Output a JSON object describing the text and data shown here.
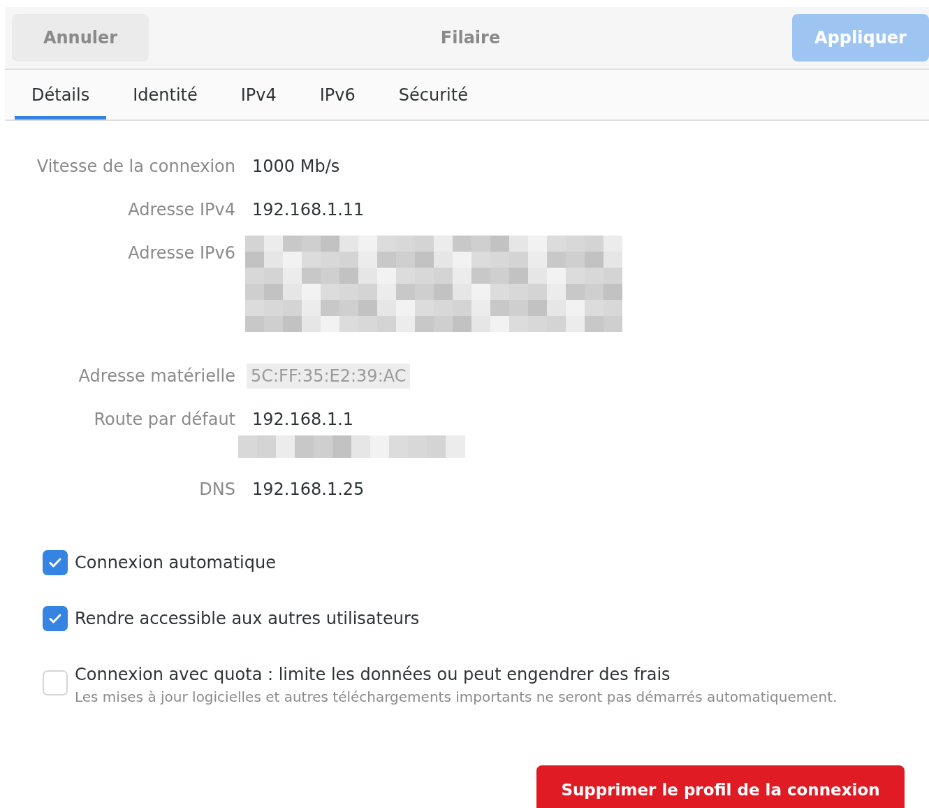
{
  "header": {
    "cancel": "Annuler",
    "title": "Filaire",
    "apply": "Appliquer",
    "apply_disabled": true
  },
  "tabs": [
    {
      "label": "Détails",
      "selected": true
    },
    {
      "label": "Identité",
      "selected": false
    },
    {
      "label": "IPv4",
      "selected": false
    },
    {
      "label": "IPv6",
      "selected": false
    },
    {
      "label": "Sécurité",
      "selected": false
    }
  ],
  "details": [
    {
      "label": "Vitesse de la connexion",
      "kind": "text",
      "value": "1000 Mb/s"
    },
    {
      "label": "Adresse IPv4",
      "kind": "text",
      "value": "192.168.1.11"
    },
    {
      "label": "Adresse IPv6",
      "kind": "redacted"
    },
    {
      "label": "Adresse matérielle",
      "kind": "faint",
      "value": "5C:FF:35:E2:39:AC"
    },
    {
      "label": "Route par défaut",
      "kind": "text_redacted",
      "value": "192.168.1.1"
    },
    {
      "label": "DNS",
      "kind": "text",
      "value": "192.168.1.25"
    }
  ],
  "options": [
    {
      "label": "Connexion automatique",
      "checked": true
    },
    {
      "label": "Rendre accessible aux autres utilisateurs",
      "checked": true
    },
    {
      "label": "Connexion avec quota : limite les données ou peut engendrer des frais",
      "checked": false,
      "note": "Les mises à jour logicielles et autres téléchargements importants ne seront pas démarrés automatiquement."
    }
  ],
  "delete_button": "Supprimer le profil de la connexion"
}
